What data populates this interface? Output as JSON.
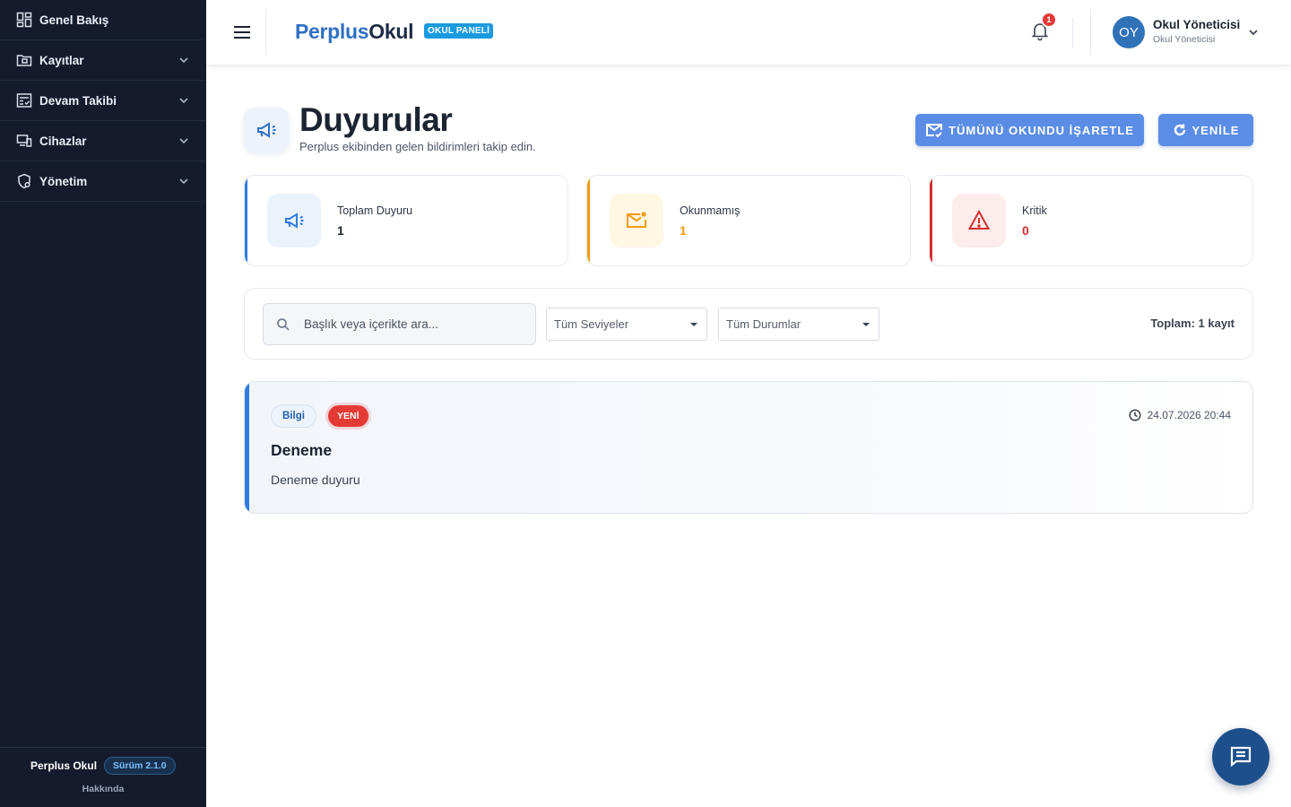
{
  "sidebar": {
    "items": [
      {
        "label": "Genel Bakış",
        "icon": "dashboard-icon"
      },
      {
        "label": "Kayıtlar",
        "icon": "folder-icon"
      },
      {
        "label": "Devam Takibi",
        "icon": "attendance-icon"
      },
      {
        "label": "Cihazlar",
        "icon": "devices-icon"
      },
      {
        "label": "Yönetim",
        "icon": "admin-shield-icon"
      }
    ],
    "footer": {
      "brand": "Perplus Okul",
      "version": "Sürüm 2.1.0",
      "about": "Hakkında"
    }
  },
  "header": {
    "logo_part1": "Perplus",
    "logo_part2": "Okul",
    "badge": "OKUL PANELİ",
    "notification_count": "1",
    "user": {
      "initials": "OY",
      "name": "Okul Yöneticisi",
      "role": "Okul Yöneticisi"
    }
  },
  "page": {
    "title": "Duyurular",
    "subtitle": "Perplus ekibinden gelen bildirimleri takip edin.",
    "mark_all_label": "TÜMÜNÜ OKUNDU İŞARETLE",
    "refresh_label": "YENİLE"
  },
  "stats": [
    {
      "label": "Toplam Duyuru",
      "value": "1"
    },
    {
      "label": "Okunmamış",
      "value": "1"
    },
    {
      "label": "Kritik",
      "value": "0"
    }
  ],
  "filters": {
    "search_placeholder": "Başlık veya içerikte ara...",
    "level_selected": "Tüm Seviyeler",
    "status_selected": "Tüm Durumlar",
    "total": "Toplam: 1 kayıt"
  },
  "announcements": [
    {
      "level": "Bilgi",
      "badge": "YENİ",
      "date": "24.07.2026 20:44",
      "title": "Deneme",
      "body": "Deneme duyuru"
    }
  ],
  "colors": {
    "sidebar_bg": "#141b2d",
    "primary": "#5b8de6",
    "accent_blue": "#2f7be0",
    "warning": "#f29a0e",
    "danger": "#d32f2f"
  }
}
